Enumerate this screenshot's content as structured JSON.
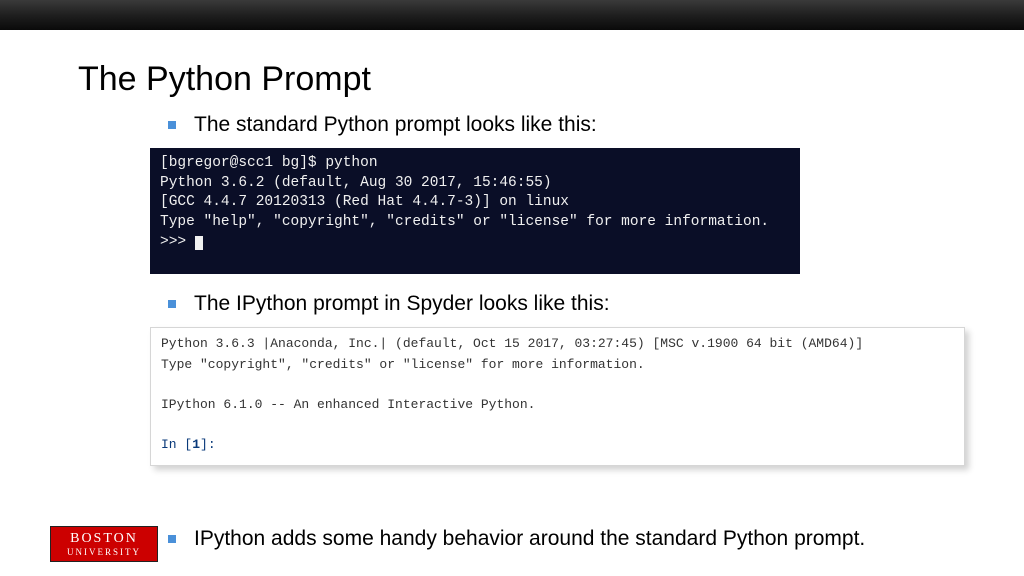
{
  "title": "The Python Prompt",
  "bullet1": "The standard Python prompt looks like this:",
  "bullet2": "The IPython prompt in Spyder looks like this:",
  "bullet3": "IPython adds some handy behavior around the standard Python prompt.",
  "terminal1": {
    "l1": "[bgregor@scc1 bg]$ python",
    "l2": "Python 3.6.2 (default, Aug 30 2017, 15:46:55)",
    "l3": "[GCC 4.4.7 20120313 (Red Hat 4.4.7-3)] on linux",
    "l4": "Type \"help\", \"copyright\", \"credits\" or \"license\" for more information.",
    "l5": ">>> "
  },
  "terminal2": {
    "l1": "Python 3.6.3 |Anaconda, Inc.| (default, Oct 15 2017, 03:27:45) [MSC v.1900 64 bit (AMD64)]",
    "l2": "Type \"copyright\", \"credits\" or \"license\" for more information.",
    "l3": "",
    "l4": "IPython 6.1.0 -- An enhanced Interactive Python.",
    "l5": "",
    "in_label": "In [",
    "in_num": "1",
    "in_close": "]:"
  },
  "logo": {
    "l1": "BOSTON",
    "l2": "UNIVERSITY"
  }
}
